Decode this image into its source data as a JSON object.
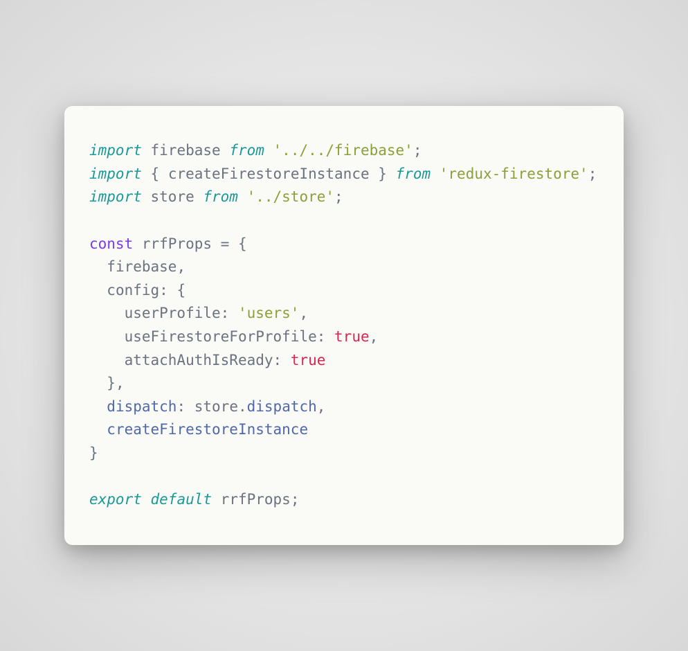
{
  "code": {
    "tokens": [
      [
        {
          "t": "import ",
          "c": "kw-import"
        },
        {
          "t": "firebase ",
          "c": "ident"
        },
        {
          "t": "from ",
          "c": "kw-from"
        },
        {
          "t": "'../../firebase'",
          "c": "string"
        },
        {
          "t": ";",
          "c": "punct"
        }
      ],
      [
        {
          "t": "import ",
          "c": "kw-import"
        },
        {
          "t": "{ ",
          "c": "brace"
        },
        {
          "t": "createFirestoreInstance",
          "c": "ident"
        },
        {
          "t": " } ",
          "c": "brace"
        },
        {
          "t": "from ",
          "c": "kw-from"
        },
        {
          "t": "'redux-firestore'",
          "c": "string"
        },
        {
          "t": ";",
          "c": "punct"
        }
      ],
      [
        {
          "t": "import ",
          "c": "kw-import"
        },
        {
          "t": "store ",
          "c": "ident"
        },
        {
          "t": "from ",
          "c": "kw-from"
        },
        {
          "t": "'../store'",
          "c": "string"
        },
        {
          "t": ";",
          "c": "punct"
        }
      ],
      [
        {
          "t": "",
          "c": ""
        }
      ],
      [
        {
          "t": "const ",
          "c": "kw-const"
        },
        {
          "t": "rrfProps",
          "c": "ident"
        },
        {
          "t": " = {",
          "c": "brace"
        }
      ],
      [
        {
          "t": "  firebase",
          "c": "ident"
        },
        {
          "t": ",",
          "c": "punct"
        }
      ],
      [
        {
          "t": "  config",
          "c": "ident"
        },
        {
          "t": ": {",
          "c": "brace"
        }
      ],
      [
        {
          "t": "    userProfile",
          "c": "ident"
        },
        {
          "t": ": ",
          "c": "punct"
        },
        {
          "t": "'users'",
          "c": "string"
        },
        {
          "t": ",",
          "c": "punct"
        }
      ],
      [
        {
          "t": "    useFirestoreForProfile",
          "c": "ident"
        },
        {
          "t": ": ",
          "c": "punct"
        },
        {
          "t": "true",
          "c": "bool"
        },
        {
          "t": ",",
          "c": "punct"
        }
      ],
      [
        {
          "t": "    attachAuthIsReady",
          "c": "ident"
        },
        {
          "t": ": ",
          "c": "punct"
        },
        {
          "t": "true",
          "c": "bool"
        }
      ],
      [
        {
          "t": "  }",
          "c": "brace"
        },
        {
          "t": ",",
          "c": "punct"
        }
      ],
      [
        {
          "t": "  dispatch",
          "c": "prop"
        },
        {
          "t": ": ",
          "c": "punct"
        },
        {
          "t": "store",
          "c": "ident"
        },
        {
          "t": ".",
          "c": "punct"
        },
        {
          "t": "dispatch",
          "c": "prop"
        },
        {
          "t": ",",
          "c": "punct"
        }
      ],
      [
        {
          "t": "  createFirestoreInstance",
          "c": "prop"
        }
      ],
      [
        {
          "t": "}",
          "c": "brace"
        }
      ],
      [
        {
          "t": "",
          "c": ""
        }
      ],
      [
        {
          "t": "export ",
          "c": "kw-export"
        },
        {
          "t": "default ",
          "c": "kw-default"
        },
        {
          "t": "rrfProps",
          "c": "ident"
        },
        {
          "t": ";",
          "c": "punct"
        }
      ]
    ]
  }
}
